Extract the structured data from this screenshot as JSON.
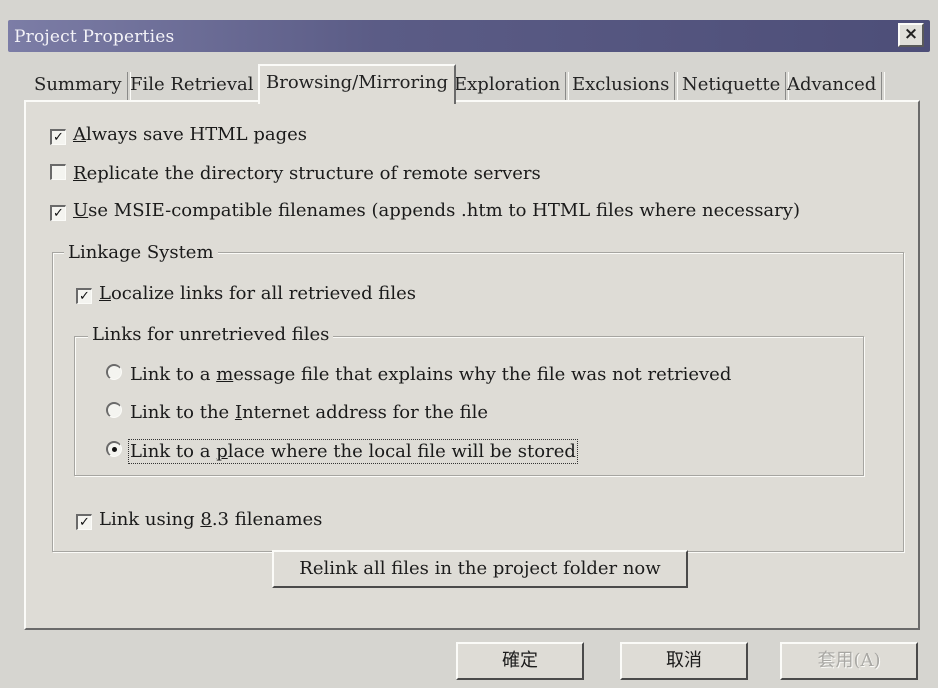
{
  "window": {
    "title": "Project Properties",
    "close_label": "×"
  },
  "tabs": [
    {
      "label": "Summary"
    },
    {
      "label": "File Retrieval"
    },
    {
      "label": "Browsing/Mirroring"
    },
    {
      "label": "Exploration"
    },
    {
      "label": "Exclusions"
    },
    {
      "label": "Netiquette"
    },
    {
      "label": "Advanced"
    }
  ],
  "options": {
    "always_save_html": {
      "pre": "",
      "key": "A",
      "post": "lways save HTML pages",
      "checked": true
    },
    "replicate_dirs": {
      "pre": "",
      "key": "R",
      "post": "eplicate the directory structure of remote servers",
      "checked": false
    },
    "msie_filenames": {
      "pre": "",
      "key": "U",
      "post": "se MSIE-compatible filenames (appends .htm to HTML files where necessary)",
      "checked": true
    }
  },
  "linkage": {
    "legend": "Linkage System",
    "localize": {
      "pre": "",
      "key": "L",
      "post": "ocalize links for all retrieved files",
      "checked": true
    },
    "unretrieved": {
      "legend": "Links for unretrieved files",
      "options": [
        {
          "pre": "Link to a ",
          "key": "m",
          "post": "essage file that explains why the file was not retrieved",
          "selected": false
        },
        {
          "pre": "Link to the ",
          "key": "I",
          "post": "nternet address for the file",
          "selected": false
        },
        {
          "pre": "Link to a ",
          "key": "p",
          "post": "lace where the local file will be stored",
          "selected": true
        }
      ]
    },
    "link83": {
      "pre": "Link using ",
      "key": "8",
      "post": ".3 filenames",
      "checked": true
    },
    "relink_label": "Relink all files in the project folder now"
  },
  "footer": {
    "ok_label": "確定",
    "cancel_label": "取消",
    "apply_label": "套用(A)"
  },
  "check_glyph": "✓"
}
